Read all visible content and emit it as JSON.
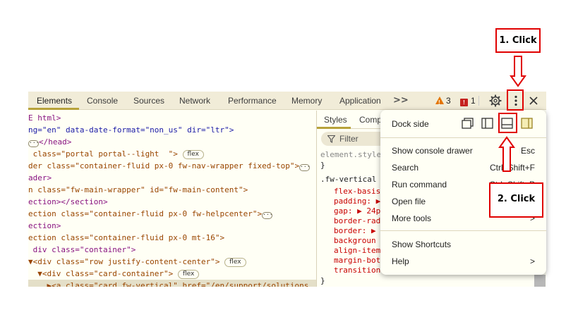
{
  "devtools": {
    "tabs": [
      "Elements",
      "Console",
      "Sources",
      "Network",
      "Performance",
      "Memory",
      "Application"
    ],
    "overflow_label": ">>",
    "warnings_count": "3",
    "issues_count": "1",
    "icons": [
      "settings-gear-icon",
      "kebab-menu-icon",
      "close-icon"
    ]
  },
  "elements_panel": {
    "lines": [
      {
        "a": "E html>"
      },
      {
        "a": "ng=\"en\" data-date-format=\"non_us\" dir=\"ltr\">"
      },
      {
        "a": "</head>"
      },
      {
        "a": " class=\"portal portal--light  \">",
        "pill": "flex"
      },
      {
        "a": "der class=\"container-fluid px-0 fw-nav-wrapper fixed-top\">"
      },
      {
        "a": "ader>"
      },
      {
        "a": "n class=\"fw-main-wrapper\" id=\"fw-main-content\">"
      },
      {
        "a": "ection></section>"
      },
      {
        "a": "ection class=\"container-fluid px-0 fw-helpcenter\">"
      },
      {
        "a": "ection>"
      },
      {
        "a": "ection class=\"container-fluid px-0 mt-16\">"
      },
      {
        "a": " div class=\"container\">"
      },
      {
        "a": "▼<div class=\"row justify-content-center\">",
        "pill": "flex"
      },
      {
        "a": "  ▼<div class=\"card-container\">",
        "pill": "flex"
      },
      {
        "a": "    ▶<a class=\"card fw-vertical\" href=\"/en/support/solutions"
      }
    ]
  },
  "styles_panel": {
    "tabs": [
      "Styles",
      "Comp"
    ],
    "filter_placeholder": "Filter",
    "element_style": "element.style",
    "close_brace": "}",
    "rule_selector": ".fw-vertical",
    "props": [
      "flex-basis",
      "padding: ▶",
      "gap: ▶ 24px",
      "border-rad",
      "border: ▶ 1",
      "backgroun",
      "align-item",
      "margin-bot",
      "transition"
    ]
  },
  "menu": {
    "dock_side_label": "Dock side",
    "dock_icons": [
      "undock-icon",
      "dock-left-icon",
      "dock-bottom-icon",
      "dock-right-icon"
    ],
    "items": [
      {
        "label": "Show console drawer",
        "shortcut": "Esc"
      },
      {
        "label": "Search",
        "shortcut": "Ctrl+Shift+F"
      },
      {
        "label": "Run command",
        "shortcut": "Ctrl+Shift+P"
      },
      {
        "label": "Open file",
        "shortcut": ""
      },
      {
        "label": "More tools",
        "shortcut": ">"
      }
    ],
    "show_shortcuts": "Show Shortcuts",
    "help": "Help",
    "help_chevron": ">"
  },
  "annotations": {
    "step1": "1. Click",
    "step2": "2. Click"
  },
  "colors": {
    "annotation_red": "#e00000",
    "accent": "#b7a23a",
    "panel_bg": "#fffff5"
  }
}
